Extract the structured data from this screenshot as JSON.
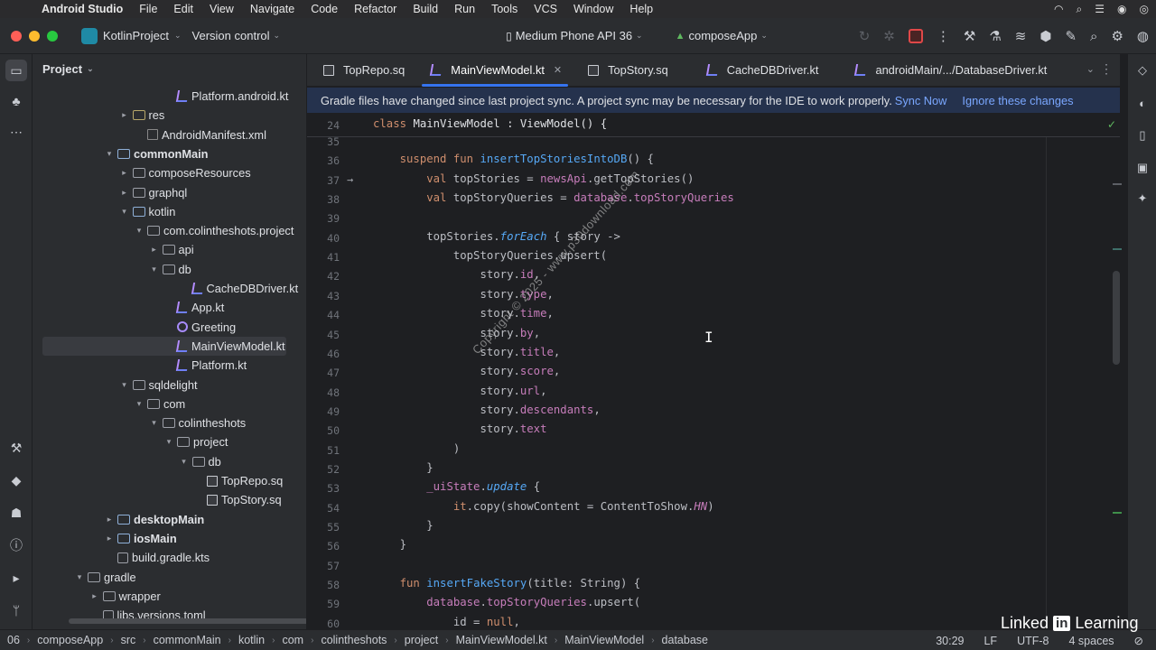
{
  "menubar": {
    "app": "Android Studio",
    "items": [
      "File",
      "Edit",
      "View",
      "Navigate",
      "Code",
      "Refactor",
      "Build",
      "Run",
      "Tools",
      "VCS",
      "Window",
      "Help"
    ]
  },
  "toolbar": {
    "project": "KotlinProject",
    "vcs": "Version control",
    "device": "Medium Phone API 36",
    "run_config": "composeApp"
  },
  "project_panel": {
    "title": "Project",
    "rows": [
      {
        "label": "Platform.android.kt",
        "indent": 8,
        "twisty": "",
        "icon": "kt"
      },
      {
        "label": "res",
        "indent": 5,
        "twisty": "▸",
        "icon": "res-folder"
      },
      {
        "label": "AndroidManifest.xml",
        "indent": 6,
        "twisty": "",
        "icon": "xml"
      },
      {
        "label": "commonMain",
        "indent": 4,
        "twisty": "▾",
        "icon": "src-folder",
        "bold": true
      },
      {
        "label": "composeResources",
        "indent": 5,
        "twisty": "▸",
        "icon": "folder"
      },
      {
        "label": "graphql",
        "indent": 5,
        "twisty": "▸",
        "icon": "folder"
      },
      {
        "label": "kotlin",
        "indent": 5,
        "twisty": "▾",
        "icon": "src-folder"
      },
      {
        "label": "com.colintheshots.project",
        "indent": 6,
        "twisty": "▾",
        "icon": "folder"
      },
      {
        "label": "api",
        "indent": 7,
        "twisty": "▸",
        "icon": "folder"
      },
      {
        "label": "db",
        "indent": 7,
        "twisty": "▾",
        "icon": "folder"
      },
      {
        "label": "CacheDBDriver.kt",
        "indent": 9,
        "twisty": "",
        "icon": "kt"
      },
      {
        "label": "App.kt",
        "indent": 8,
        "twisty": "",
        "icon": "kt"
      },
      {
        "label": "Greeting",
        "indent": 8,
        "twisty": "",
        "icon": "compose"
      },
      {
        "label": "MainViewModel.kt",
        "indent": 8,
        "twisty": "",
        "icon": "kt",
        "selected": true
      },
      {
        "label": "Platform.kt",
        "indent": 8,
        "twisty": "",
        "icon": "kt"
      },
      {
        "label": "sqldelight",
        "indent": 5,
        "twisty": "▾",
        "icon": "folder"
      },
      {
        "label": "com",
        "indent": 6,
        "twisty": "▾",
        "icon": "folder"
      },
      {
        "label": "colintheshots",
        "indent": 7,
        "twisty": "▾",
        "icon": "folder"
      },
      {
        "label": "project",
        "indent": 8,
        "twisty": "▾",
        "icon": "folder"
      },
      {
        "label": "db",
        "indent": 9,
        "twisty": "▾",
        "icon": "folder"
      },
      {
        "label": "TopRepo.sq",
        "indent": 10,
        "twisty": "",
        "icon": "sq"
      },
      {
        "label": "TopStory.sq",
        "indent": 10,
        "twisty": "",
        "icon": "sq"
      },
      {
        "label": "desktopMain",
        "indent": 4,
        "twisty": "▸",
        "icon": "src-folder",
        "bold": true
      },
      {
        "label": "iosMain",
        "indent": 4,
        "twisty": "▸",
        "icon": "src-folder",
        "bold": true
      },
      {
        "label": "build.gradle.kts",
        "indent": 4,
        "twisty": "",
        "icon": "gradle"
      },
      {
        "label": "gradle",
        "indent": 2,
        "twisty": "▾",
        "icon": "folder"
      },
      {
        "label": "wrapper",
        "indent": 3,
        "twisty": "▸",
        "icon": "folder"
      },
      {
        "label": "libs.versions.toml",
        "indent": 3,
        "twisty": "",
        "icon": "gradle"
      }
    ]
  },
  "tabs": [
    {
      "label": "TopRepo.sq",
      "icon": "sq"
    },
    {
      "label": "MainViewModel.kt",
      "icon": "kt",
      "active": true
    },
    {
      "label": "TopStory.sq",
      "icon": "sq"
    },
    {
      "label": "CacheDBDriver.kt",
      "icon": "kt"
    },
    {
      "label": "androidMain/.../DatabaseDriver.kt",
      "icon": "kt"
    }
  ],
  "banner": {
    "message": "Gradle files have changed since last project sync. A project sync may be necessary for the IDE to work properly.",
    "sync": "Sync Now",
    "ignore": "Ignore these changes"
  },
  "sticky": {
    "num": "24",
    "text": "class MainViewModel : ViewModel() {"
  },
  "code_lines": [
    {
      "num": "35",
      "html": ""
    },
    {
      "num": "36",
      "html": "    <span class='k'>suspend fun</span> <span class='f'>insertTopStoriesIntoDB</span>() {"
    },
    {
      "num": "37",
      "html": "        <span class='k'>val</span> topStories = <span class='p'>newsApi</span>.getTopStories()",
      "mark": "→"
    },
    {
      "num": "38",
      "html": "        <span class='k'>val</span> topStoryQueries = <span class='p'>database</span>.<span class='p'>topStoryQueries</span>"
    },
    {
      "num": "39",
      "html": ""
    },
    {
      "num": "40",
      "html": "        topStories.<span class='ext'>forEach</span> { story ->"
    },
    {
      "num": "41",
      "html": "            topStoryQueries.upsert("
    },
    {
      "num": "42",
      "html": "                story.<span class='p'>id</span>,"
    },
    {
      "num": "43",
      "html": "                story.<span class='p'>type</span>,"
    },
    {
      "num": "44",
      "html": "                story.<span class='p'>time</span>,"
    },
    {
      "num": "45",
      "html": "                story.<span class='p'>by</span>,"
    },
    {
      "num": "46",
      "html": "                story.<span class='p'>title</span>,"
    },
    {
      "num": "47",
      "html": "                story.<span class='p'>score</span>,"
    },
    {
      "num": "48",
      "html": "                story.<span class='p'>url</span>,"
    },
    {
      "num": "49",
      "html": "                story.<span class='p'>descendants</span>,"
    },
    {
      "num": "50",
      "html": "                story.<span class='p'>text</span>"
    },
    {
      "num": "51",
      "html": "            )"
    },
    {
      "num": "52",
      "html": "        }"
    },
    {
      "num": "53",
      "html": "        <span class='p'>_uiState</span>.<span class='ext'>update</span> {"
    },
    {
      "num": "54",
      "html": "            <span class='k'>it</span>.copy(<span class='dim'>showContent</span> = ContentToShow.<span class='cn'>HN</span>)"
    },
    {
      "num": "55",
      "html": "        }"
    },
    {
      "num": "56",
      "html": "    }"
    },
    {
      "num": "57",
      "html": ""
    },
    {
      "num": "58",
      "html": "    <span class='k'>fun</span> <span class='f'>insertFakeStory</span>(title: String) {"
    },
    {
      "num": "59",
      "html": "        <span class='p'>database</span>.<span class='p'>topStoryQueries</span>.upsert("
    },
    {
      "num": "60",
      "html": "            <span class='dim'>id</span> = <span class='k'>null</span>,"
    }
  ],
  "status": {
    "crumbs": [
      "06",
      "composeApp",
      "src",
      "commonMain",
      "kotlin",
      "com",
      "colintheshots",
      "project",
      "MainViewModel.kt",
      "MainViewModel",
      "database"
    ],
    "position": "30:29",
    "line_sep": "LF",
    "encoding": "UTF-8",
    "indent": "4 spaces"
  },
  "watermark": "Copyright © 2025 - www.p30download.com",
  "brand": {
    "left": "Linked",
    "box": "in",
    "right": "Learning"
  },
  "colors": {
    "accent": "#3574f0",
    "keyword": "#cf8e6d",
    "function": "#56a8f5",
    "property": "#c77dbb",
    "banner": "#25324d"
  }
}
